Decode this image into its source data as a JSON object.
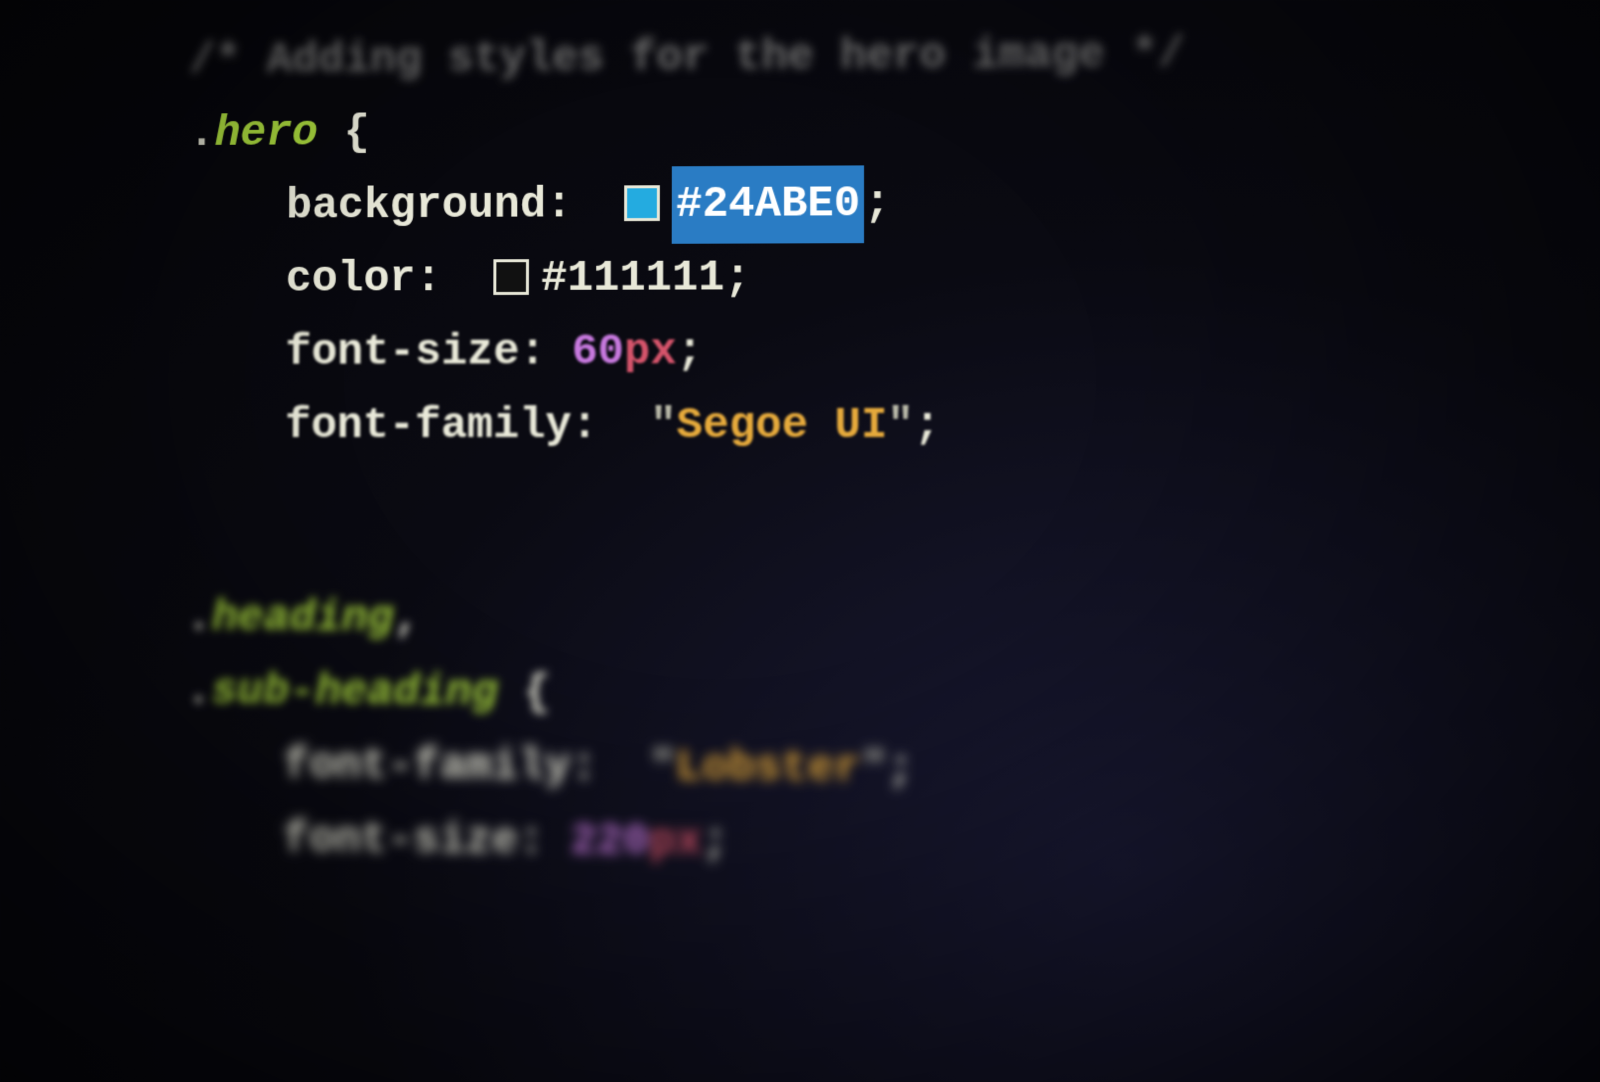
{
  "code": {
    "comment": "/* Adding styles for the hero image */",
    "rule1": {
      "dot": ".",
      "selector": "hero",
      "open": " {",
      "bg_prop": "background",
      "bg_val": "#24ABE0",
      "bg_swatch": "#24ABE0",
      "color_prop": "color",
      "color_val": "#111111",
      "color_swatch": "#111111",
      "fsize_prop": "font-size",
      "fsize_num": "60",
      "fsize_unit": "px",
      "ffam_prop": "font-family",
      "ffam_val": "Segoe UI"
    },
    "rule2": {
      "dot1": ".",
      "sel1": "heading",
      "comma": ",",
      "dot2": ".",
      "sel2": "sub-heading",
      "open": " {",
      "ffam_prop": "font-family",
      "ffam_val": "Lobster",
      "fsize_prop": "font-size",
      "fsize_num": "220",
      "fsize_unit": "px"
    },
    "punct": {
      "colon": ":",
      "semi": ";",
      "quote": "\"",
      "space": " "
    }
  }
}
